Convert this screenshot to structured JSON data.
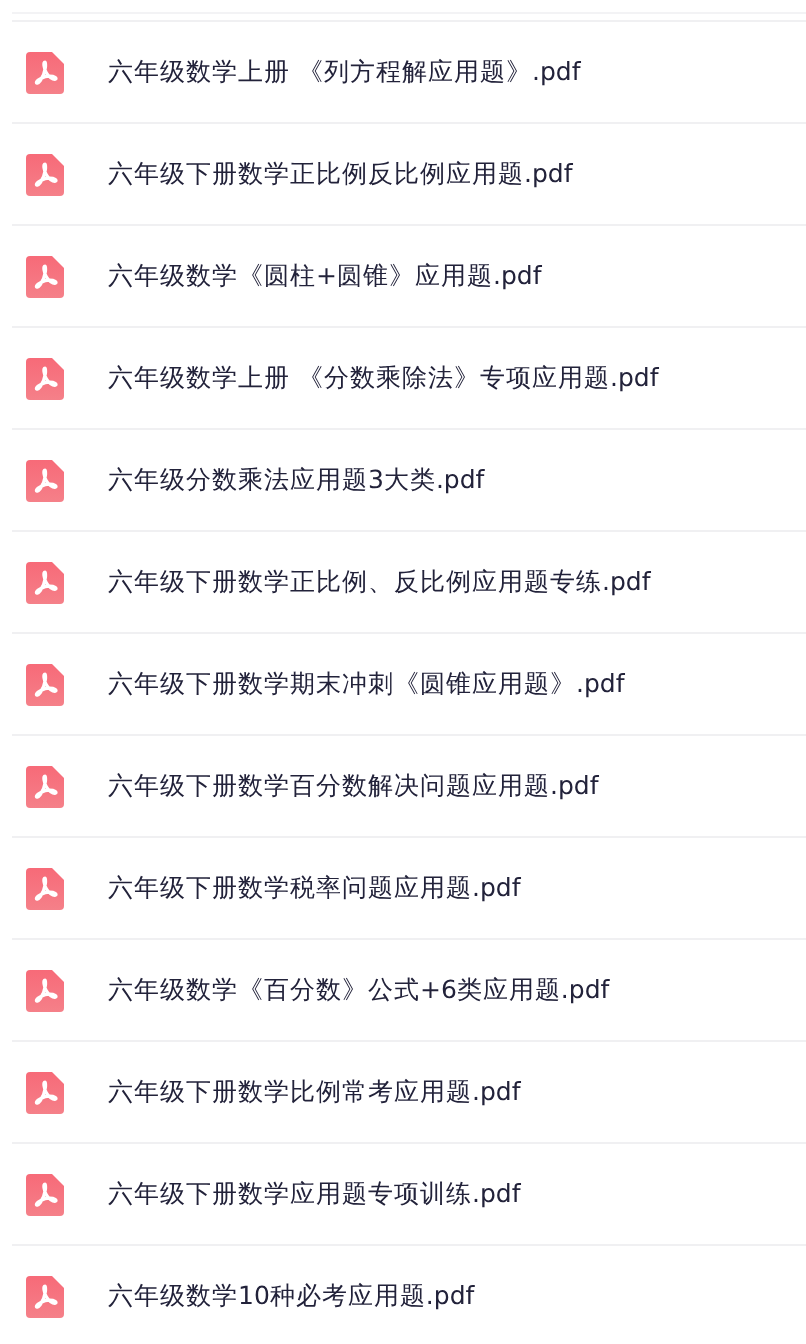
{
  "files": [
    {
      "name": "六年级数学上册 《列方程解应用题》.pdf"
    },
    {
      "name": "六年级下册数学正比例反比例应用题.pdf"
    },
    {
      "name": "六年级数学《圆柱+圆锥》应用题.pdf"
    },
    {
      "name": "六年级数学上册 《分数乘除法》专项应用题.pdf"
    },
    {
      "name": "六年级分数乘法应用题3大类.pdf"
    },
    {
      "name": "六年级下册数学正比例、反比例应用题专练.pdf"
    },
    {
      "name": "六年级下册数学期末冲刺《圆锥应用题》.pdf"
    },
    {
      "name": "六年级下册数学百分数解决问题应用题.pdf"
    },
    {
      "name": "六年级下册数学税率问题应用题.pdf"
    },
    {
      "name": "六年级数学《百分数》公式+6类应用题.pdf"
    },
    {
      "name": "六年级下册数学比例常考应用题.pdf"
    },
    {
      "name": "六年级下册数学应用题专项训练.pdf"
    },
    {
      "name": "六年级数学10种必考应用题.pdf"
    }
  ]
}
